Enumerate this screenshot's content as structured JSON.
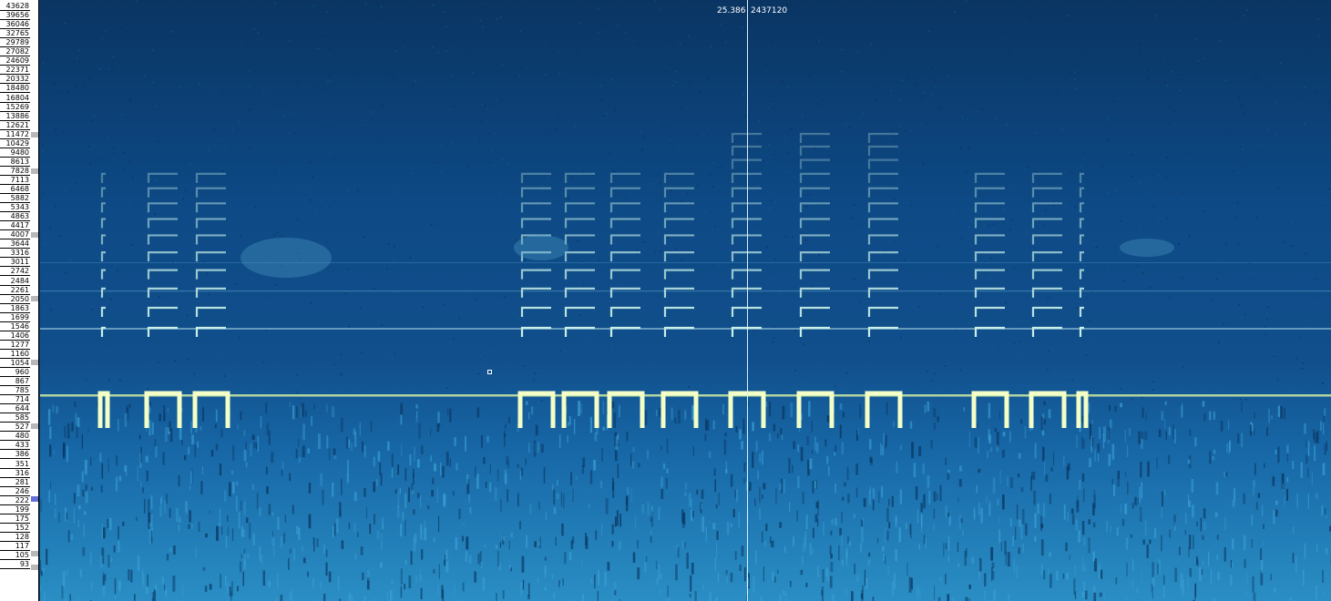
{
  "ruler": {
    "ticks": [
      "43628",
      "39656",
      "36046",
      "32765",
      "29789",
      "27082",
      "24609",
      "22371",
      "20332",
      "18480",
      "16804",
      "15269",
      "13886",
      "12621",
      "11472",
      "10429",
      "9480",
      "8613",
      "7828",
      "7113",
      "6468",
      "5882",
      "5343",
      "4863",
      "4417",
      "4007",
      "3644",
      "3316",
      "3011",
      "2742",
      "2484",
      "2261",
      "2050",
      "1863",
      "1699",
      "1546",
      "1406",
      "1277",
      "1160",
      "1054",
      "960",
      "867",
      "785",
      "714",
      "644",
      "585",
      "527",
      "480",
      "433",
      "386",
      "351",
      "316",
      "281",
      "246",
      "222",
      "199",
      "175",
      "152",
      "128",
      "117",
      "105",
      "93"
    ]
  },
  "cursor": {
    "time": "25.386",
    "sample": "2437120"
  },
  "colors": {
    "background": "#0b3d6e",
    "signal": "#f4ffc8",
    "cursor_line": "#d8f0ff"
  }
}
